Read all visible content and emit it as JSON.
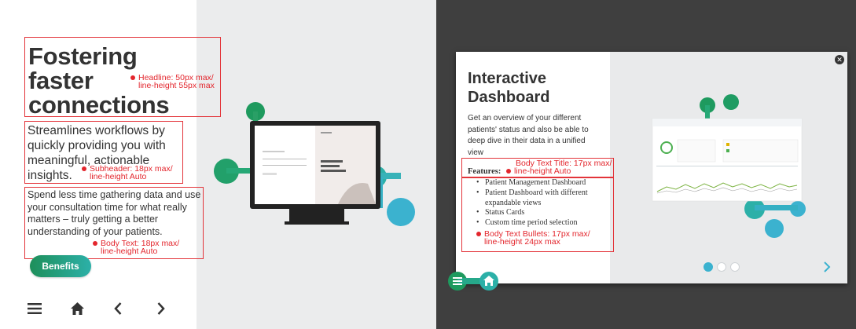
{
  "left": {
    "headline": [
      "Fostering",
      "faster",
      "connections"
    ],
    "headline_annotation": [
      "Headline: 50px max/",
      "line-height 55px max"
    ],
    "subheader": "Streamlines workflows by quickly providing you with meaningful, actionable insights.",
    "subheader_annotation": [
      "Subheader: 18px max/",
      "line-height Auto"
    ],
    "body": "Spend less time gathering data and use your consultation time for what really matters – truly getting a better understanding of your patients.",
    "body_annotation": [
      "Body Text: 18px max/",
      "line-height Auto"
    ],
    "button_label": "Benefits",
    "nav_icons": [
      "menu-icon",
      "home-icon",
      "chevron-left-icon",
      "chevron-right-icon"
    ],
    "device_screen": {
      "signin": "Sign in",
      "logo": "Roche",
      "headline": [
        "Fostering",
        "Faster",
        "Connections"
      ]
    }
  },
  "modal": {
    "title": [
      "Interactive",
      "Dashboard"
    ],
    "body": "Get an overview of your different patients' status and also be able to deep dive in their data in a unified view",
    "features_label": "Features:",
    "features_annotation": [
      "Body Text Title: 17px max/",
      "line-height Auto"
    ],
    "bullets": [
      "Patient Management Dashboard",
      "Patient Dashboard with different expandable views",
      "Status Cards",
      "Custom time period selection"
    ],
    "bullets_annotation": [
      "Body Text Bullets: 17px max/",
      "line-height 24px max"
    ],
    "close_icon": "close-icon",
    "pagination": {
      "count": 3,
      "active": 1
    }
  },
  "colors": {
    "annotation_red": "#e3262d",
    "green": "#1e9a5e",
    "teal": "#2cb0a8",
    "light_blue": "#3bb2cf",
    "dark_bg": "#3f3f3f"
  }
}
